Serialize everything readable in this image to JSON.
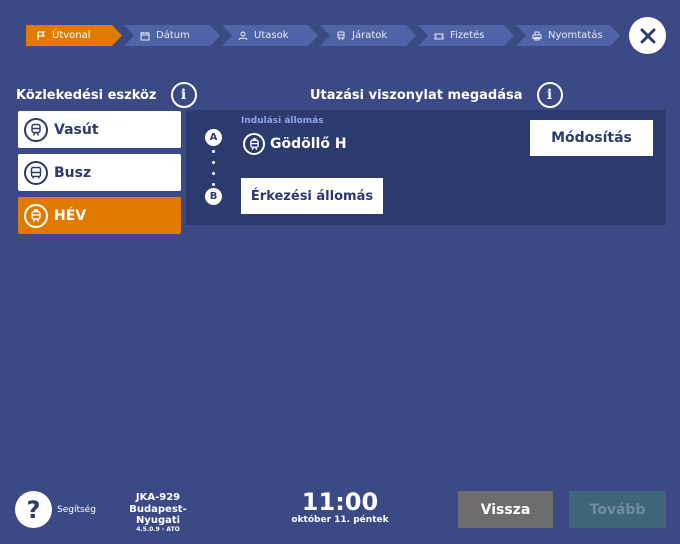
{
  "steps": [
    {
      "label": "Útvonal",
      "icon": "flag-icon",
      "active": true
    },
    {
      "label": "Dátum",
      "icon": "calendar-icon",
      "active": false
    },
    {
      "label": "Utasok",
      "icon": "person-icon",
      "active": false
    },
    {
      "label": "Járatok",
      "icon": "train-icon",
      "active": false
    },
    {
      "label": "Fizetés",
      "icon": "ticket-icon",
      "active": false
    },
    {
      "label": "Nyomtatás",
      "icon": "printer-icon",
      "active": false
    }
  ],
  "close_icon": "close-icon",
  "left_panel": {
    "heading": "Közlekedési eszköz",
    "info_label": "i",
    "options": [
      {
        "label": "Vasút",
        "icon": "train-icon",
        "selected": false
      },
      {
        "label": "Busz",
        "icon": "bus-icon",
        "selected": false
      },
      {
        "label": "HÉV",
        "icon": "suburban-train-icon",
        "selected": true
      }
    ]
  },
  "route": {
    "heading": "Utazási viszonylat megadása",
    "info_label": "i",
    "marker_a": "A",
    "marker_b": "B",
    "departure_label": "Indulási állomás",
    "departure_station": "Gödöllő H",
    "modify_label": "Módosítás",
    "arrival_placeholder": "Érkezési állomás"
  },
  "footer": {
    "help_symbol": "?",
    "help_label": "Segítség",
    "device_id": "JKA-929",
    "device_location": "Budapest-Nyugati",
    "version": "4.5.0.9 - ATO",
    "time": "11:00",
    "date": "október 11. péntek",
    "back_label": "Vissza",
    "next_label": "Tovább"
  },
  "colors": {
    "background": "#3b4a85",
    "panel": "#2c3a6e",
    "accent": "#e07b00",
    "step_inactive": "#4f63a6",
    "back_button": "#6d6d6d",
    "next_button_disabled": "#3e6579"
  }
}
